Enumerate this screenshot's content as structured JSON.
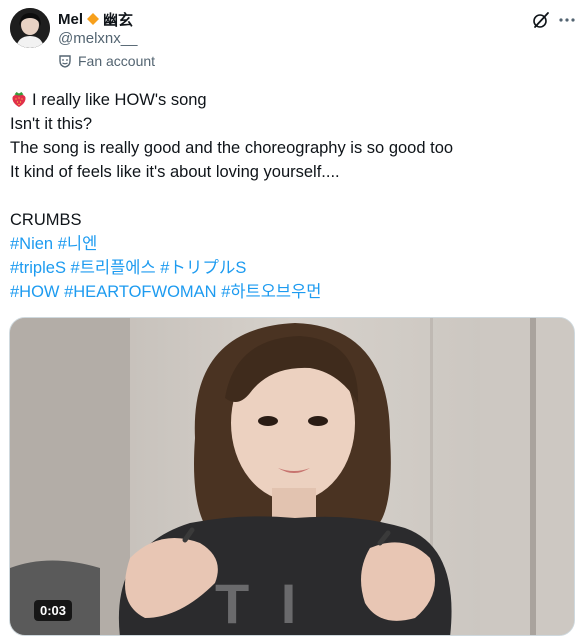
{
  "author": {
    "display_name": "Mel",
    "display_name_suffix": "幽玄",
    "handle": "@melxnx__",
    "label": "Fan account",
    "avatar_icon": "profile-photo",
    "diamond_color": "#f7a01c"
  },
  "actions": {
    "grok_icon": "grok-icon",
    "more_icon": "more-icon"
  },
  "tweet": {
    "line1": "I really like HOW's song",
    "line2": "Isn't it this?",
    "line3": "The song is really good and the choreography is so good too",
    "line4": "It kind of feels like it's about loving yourself....",
    "line5": "CRUMBS",
    "hashtags_row1": [
      "#Nien",
      "#니엔"
    ],
    "hashtags_row2": [
      "#tripleS",
      "#트리플에스",
      "#トリプルS"
    ],
    "hashtags_row3": [
      "#HOW",
      "#HEARTOFWOMAN",
      "#하트오브우먼"
    ]
  },
  "media": {
    "type": "video",
    "duration": "0:03",
    "overlay_text": "T I"
  },
  "colors": {
    "text": "#0f1419",
    "secondary": "#536471",
    "link": "#1d9bf0"
  }
}
